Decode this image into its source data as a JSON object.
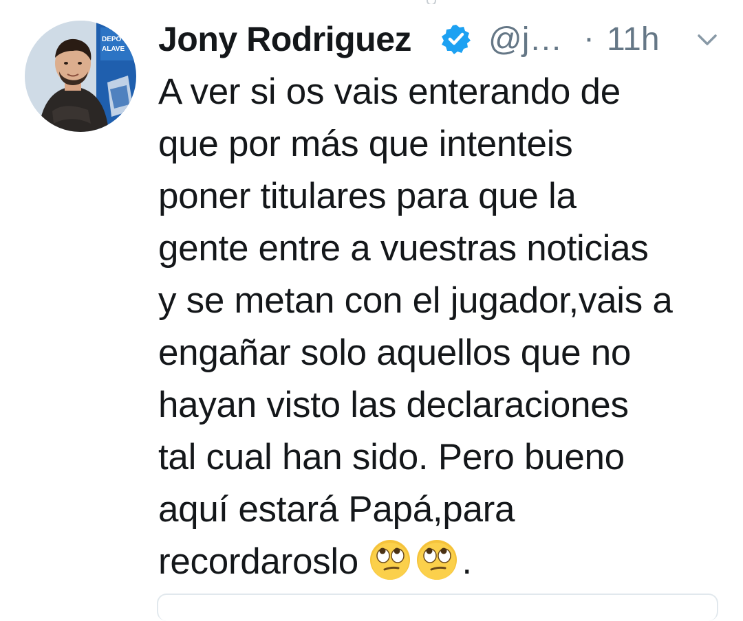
{
  "tweet": {
    "author": {
      "display_name": "Jony Rodriguez",
      "handle": "@j…",
      "verified": true
    },
    "separator": "·",
    "timestamp": "11h",
    "text": "A ver si os vais enterando de\nque por más que intenteis\nponer titulares para que la\ngente entre a vuestras noticias\ny se metan con el jugador,vais a\nengañar solo aquellos que no\nhayan visto las declaraciones\ntal cual han sido. Pero bueno\naquí estará Papá,para\nrecordaroslo ",
    "text_end": ".",
    "emojis": [
      "face-with-rolling-eyes-icon",
      "face-with-rolling-eyes-icon"
    ],
    "avatar_badge_text": [
      "DEPO",
      "ALAVE"
    ]
  },
  "colors": {
    "primary_text": "#14171a",
    "secondary_text": "#657786",
    "verified_blue": "#1da1f2",
    "card_border": "#e1e8ed"
  }
}
